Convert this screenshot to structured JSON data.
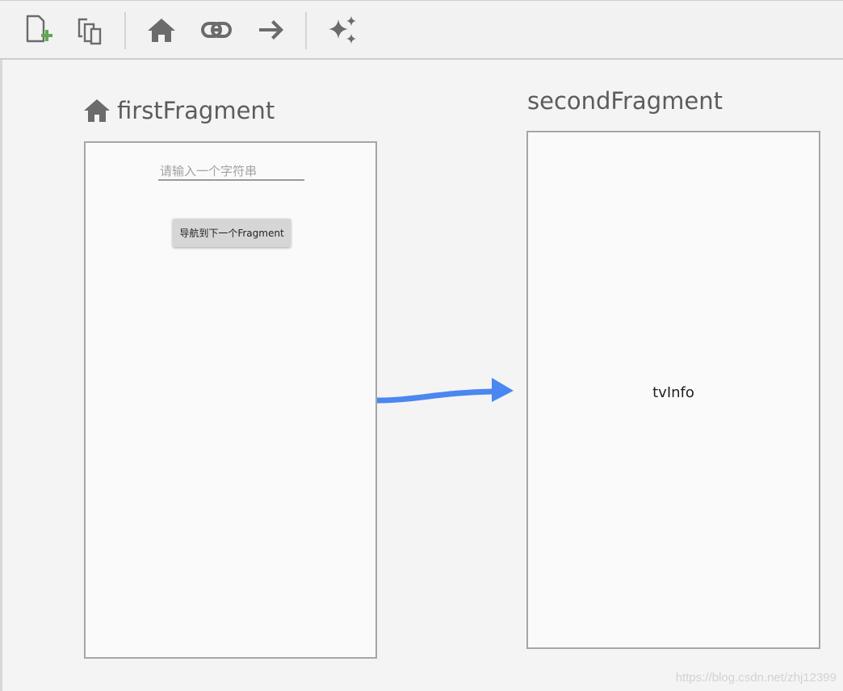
{
  "toolbar": {
    "buttons": [
      {
        "name": "new-destination",
        "icon": "new-destination-icon"
      },
      {
        "name": "nested-graph",
        "icon": "nested-graph-icon"
      },
      {
        "name": "assign-start-destination",
        "icon": "home-icon"
      },
      {
        "name": "deeplink",
        "icon": "link-icon"
      },
      {
        "name": "add-action",
        "icon": "arrow-right-icon"
      },
      {
        "name": "auto-arrange",
        "icon": "sparkle-icon"
      }
    ],
    "colors": {
      "icon": "#6b6b6b",
      "accent_plus": "#5fa94e"
    }
  },
  "destinations": {
    "first": {
      "title": "firstFragment",
      "is_start": true,
      "input_hint": "请输入一个字符串",
      "button_label": "导航到下一个Fragment"
    },
    "second": {
      "title": "secondFragment",
      "text_view": "tvInfo"
    }
  },
  "action": {
    "from": "firstFragment",
    "to": "secondFragment",
    "color": "#4a87f0"
  },
  "watermark": "https://blog.csdn.net/zhj12399"
}
